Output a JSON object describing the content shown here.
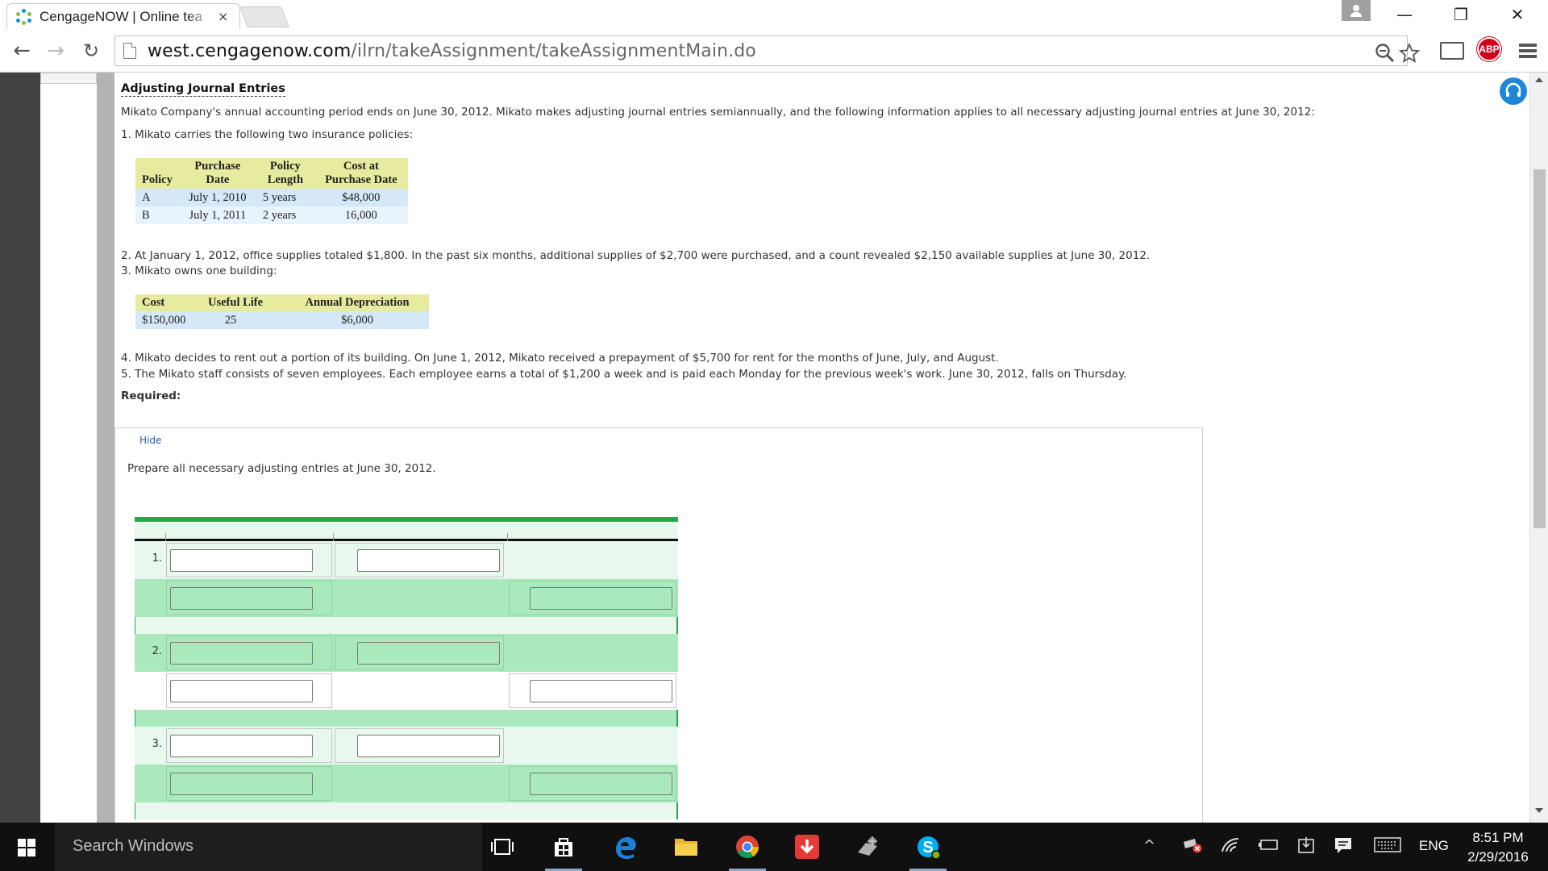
{
  "browser": {
    "tab_title": "CengageNOW | Online tea",
    "tab_close": "×",
    "url_host": "west.cengagenow.com",
    "url_path": "/ilrn/takeAssignment/takeAssignmentMain.do",
    "abp_label": "ABP",
    "window_controls": {
      "minimize": "—",
      "restore": "❐",
      "close": "✕"
    }
  },
  "exercise": {
    "title": "Adjusting Journal Entries",
    "intro": "Mikato Company's annual accounting period ends on June 30, 2012. Mikato makes adjusting journal entries semiannually, and the following information applies to all necessary adjusting journal entries at June 30, 2012:",
    "item1": "1.  Mikato carries the following two insurance policies:",
    "insurance_table": {
      "headers": [
        "Policy",
        "Purchase Date",
        "Policy Length",
        "Cost at Purchase Date"
      ],
      "header_lines": [
        [
          "",
          "Policy"
        ],
        [
          "Purchase",
          "Date"
        ],
        [
          "Policy",
          "Length"
        ],
        [
          "Cost at",
          "Purchase Date"
        ]
      ],
      "rows": [
        [
          "A",
          "July 1, 2010",
          "5 years",
          "$48,000"
        ],
        [
          "B",
          "July 1, 2011",
          "2 years",
          "16,000"
        ]
      ]
    },
    "item2": "2.  At January 1, 2012, office supplies totaled $1,800. In the past six months, additional supplies of $2,700 were purchased, and a count revealed $2,150 available supplies at June 30, 2012.",
    "item3": "3.  Mikato owns one building:",
    "building_table": {
      "headers": [
        "Cost",
        "Useful Life",
        "Annual Depreciation"
      ],
      "rows": [
        [
          "$150,000",
          "25",
          "$6,000"
        ]
      ]
    },
    "item4": "4.  Mikato decides to rent out a portion of its building. On June 1, 2012, Mikato received a prepayment of $5,700 for rent for the months of June, July, and August.",
    "item5": "5.  The Mikato staff consists of seven employees. Each employee earns a total of $1,200 a week and is paid each Monday for the previous week's work. June 30, 2012, falls on Thursday.",
    "required_label": "Required:",
    "hide_link": "Hide",
    "prepare_text": "Prepare all necessary adjusting entries at June 30, 2012."
  },
  "journal": {
    "entries": [
      {
        "number": "1."
      },
      {
        "number": "2."
      },
      {
        "number": "3."
      }
    ],
    "values": {
      "r1a": "",
      "r1b": "",
      "r2a": "",
      "r2c": "",
      "r3a": "",
      "r3b": "",
      "r4a": "",
      "r4c": "",
      "r5a": "",
      "r5b": "",
      "r6a": "",
      "r6c": ""
    }
  },
  "taskbar": {
    "search_placeholder": "Search Windows",
    "language": "ENG",
    "time": "8:51 PM",
    "date": "2/29/2016"
  },
  "colors": {
    "table_header": "#e6eb9f",
    "table_row": "#d4e8f7",
    "journal_green": "#21a94a",
    "journal_row_green": "#a9e9bb",
    "abp_red": "#d0021b"
  }
}
